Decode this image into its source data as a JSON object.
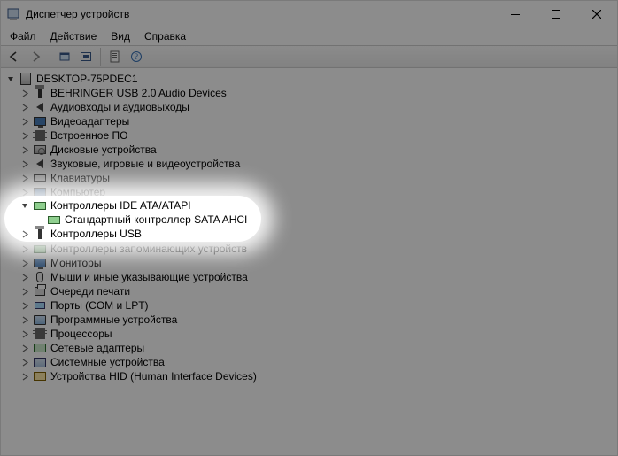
{
  "window": {
    "title": "Диспетчер устройств"
  },
  "menu": {
    "file": "Файл",
    "action": "Действие",
    "view": "Вид",
    "help": "Справка"
  },
  "toolbar": {
    "back": "back-icon",
    "forward": "forward-icon",
    "up": "show-hidden-icon",
    "refresh": "refresh-icon",
    "prop": "properties-icon",
    "help": "help-icon"
  },
  "tree": {
    "root": "DESKTOP-75PDEC1",
    "items": [
      {
        "label": "BEHRINGER USB 2.0 Audio Devices"
      },
      {
        "label": "Аудиовходы и аудиовыходы"
      },
      {
        "label": "Видеоадаптеры"
      },
      {
        "label": "Встроенное ПО"
      },
      {
        "label": "Дисковые устройства"
      },
      {
        "label": "Звуковые, игровые и видеоустройства"
      },
      {
        "label": "Клавиатуры"
      },
      {
        "label": "Компьютер"
      },
      {
        "label": "Контроллеры IDE ATA/ATAPI",
        "expanded": true,
        "children": [
          {
            "label": "Стандартный контроллер SATA AHCI"
          }
        ]
      },
      {
        "label": "Контроллеры USB"
      },
      {
        "label": "Контроллеры запоминающих устройств"
      },
      {
        "label": "Мониторы"
      },
      {
        "label": "Мыши и иные указывающие устройства"
      },
      {
        "label": "Очереди печати"
      },
      {
        "label": "Порты (COM и LPT)"
      },
      {
        "label": "Программные устройства"
      },
      {
        "label": "Процессоры"
      },
      {
        "label": "Сетевые адаптеры"
      },
      {
        "label": "Системные устройства"
      },
      {
        "label": "Устройства HID (Human Interface Devices)"
      }
    ]
  }
}
